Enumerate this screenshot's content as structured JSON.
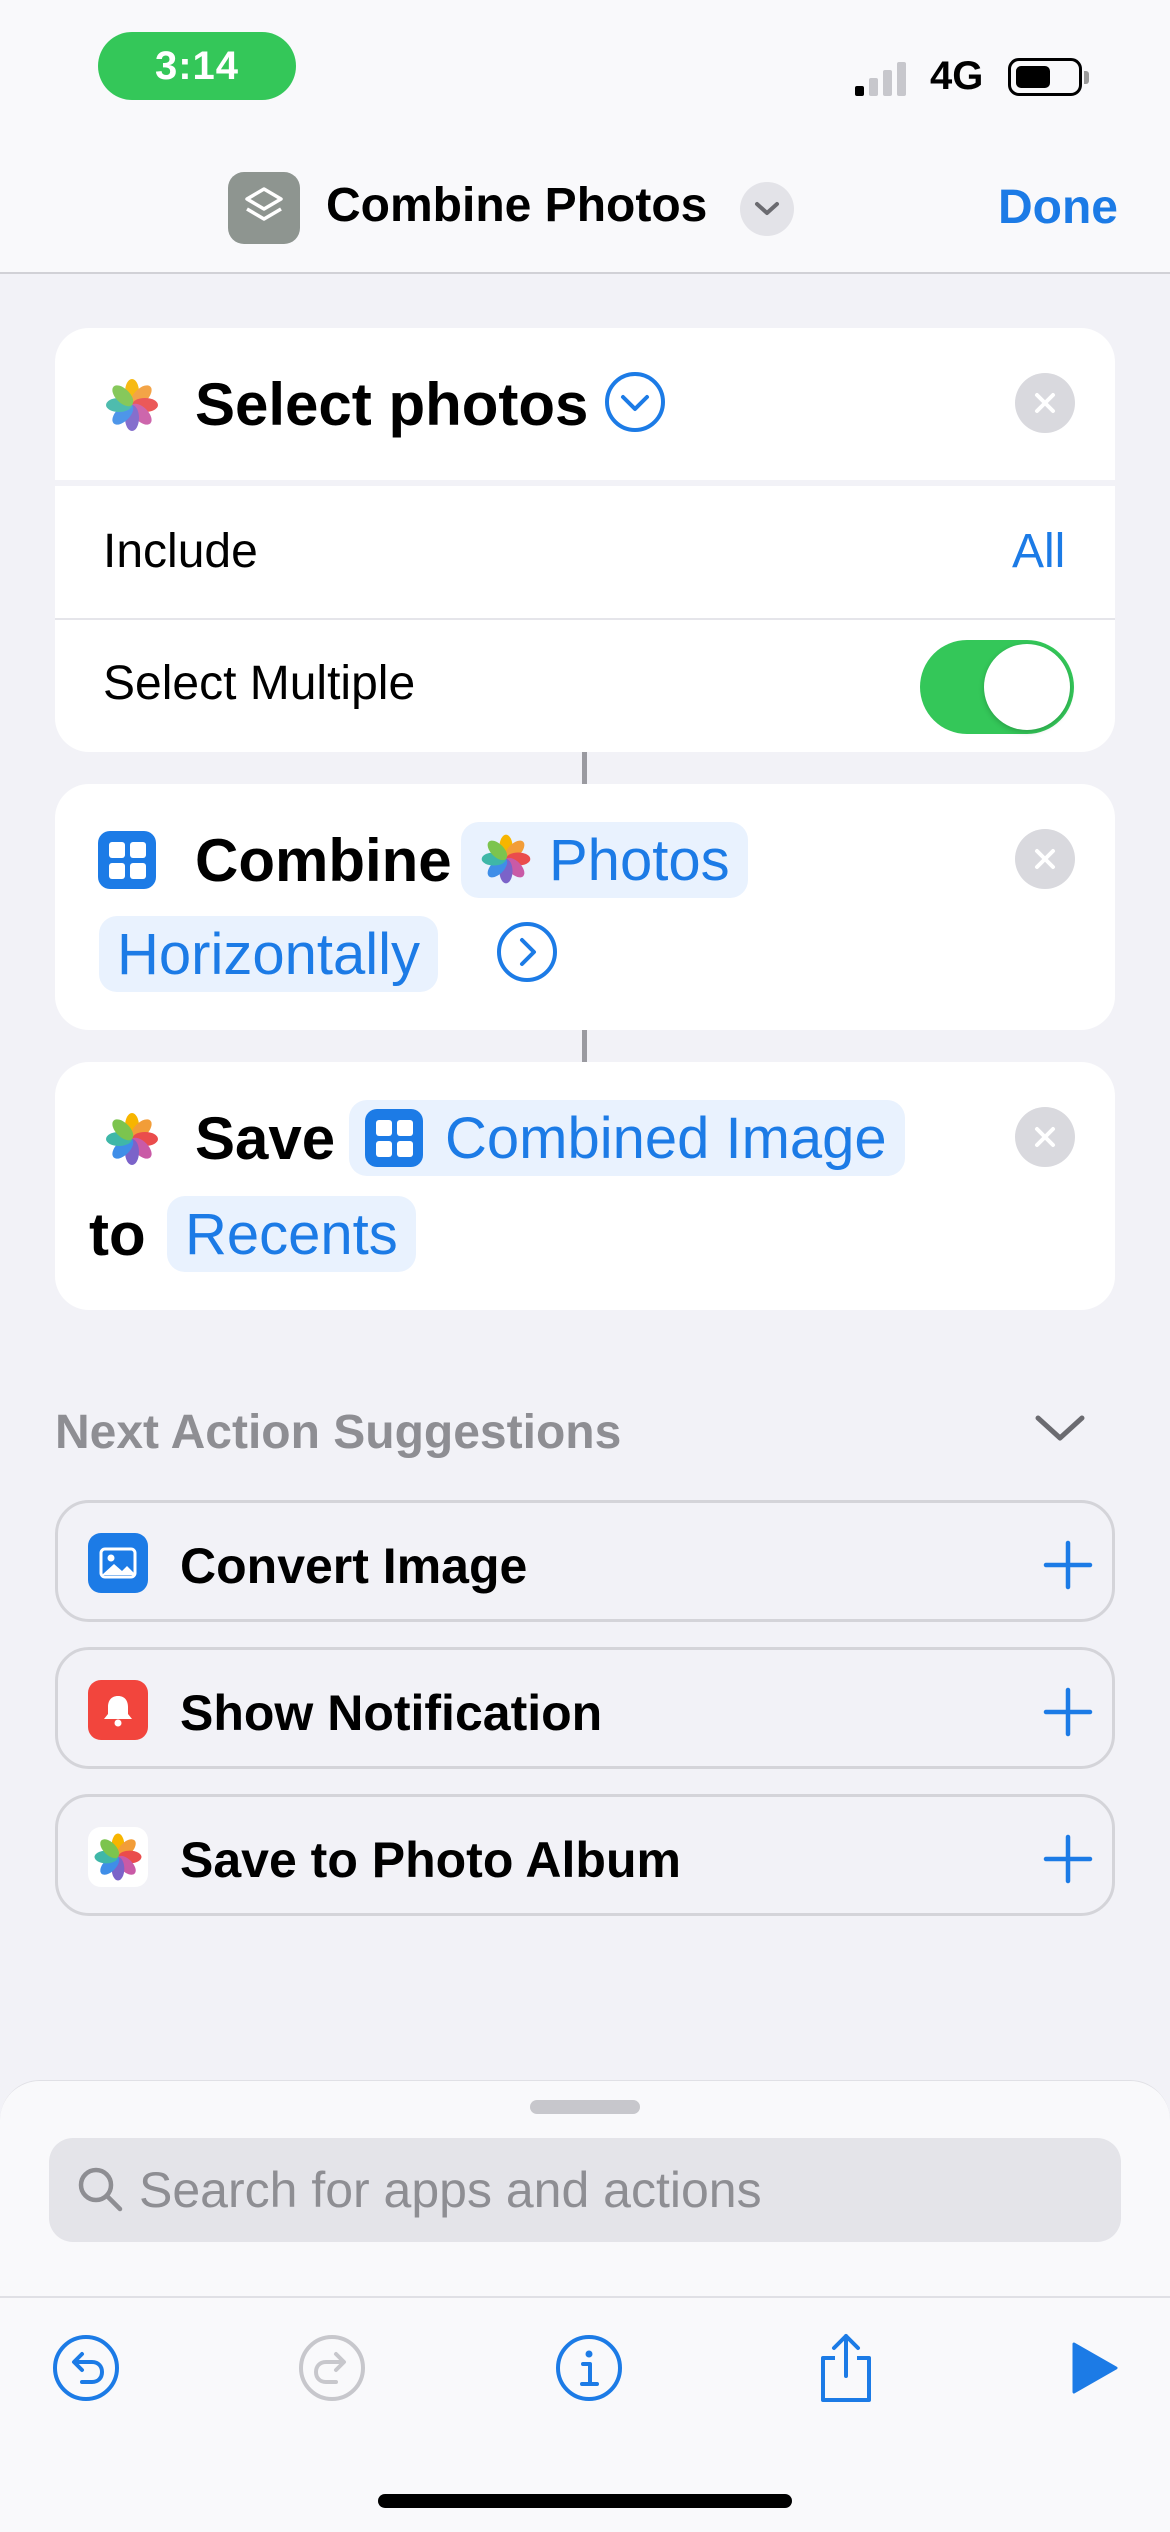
{
  "status_bar": {
    "time": "3:14",
    "network": "4G"
  },
  "nav": {
    "title": "Combine Photos",
    "done_label": "Done",
    "app_icon": "shortcuts-layers-icon",
    "menu_icon": "chevron-down-icon"
  },
  "actions": [
    {
      "id": "select-photos",
      "title": "Select photos",
      "icon": "photos-app-icon",
      "rows": [
        {
          "label": "Include",
          "value": "All"
        },
        {
          "label": "Select Multiple",
          "toggle": true
        }
      ]
    },
    {
      "id": "combine",
      "title": "Combine",
      "input_token": "Photos",
      "mode_token": "Horizontally",
      "icon": "combine-images-icon"
    },
    {
      "id": "save",
      "title": "Save",
      "input_token": "Combined Image",
      "preposition": "to",
      "destination_token": "Recents",
      "icon": "photos-app-icon"
    }
  ],
  "suggestions": {
    "header": "Next Action Suggestions",
    "items": [
      {
        "label": "Convert Image",
        "icon": "image-icon",
        "color": "#1c7be6"
      },
      {
        "label": "Show Notification",
        "icon": "bell-icon",
        "color": "#f2453d"
      },
      {
        "label": "Save to Photo Album",
        "icon": "photos-app-icon",
        "color": "#ffffff"
      }
    ]
  },
  "bottom_sheet": {
    "search_placeholder": "Search for apps and actions"
  },
  "toolbar": {
    "buttons": [
      "undo-icon",
      "redo-icon",
      "info-icon",
      "share-icon",
      "play-icon"
    ]
  },
  "colors": {
    "accent": "#1c7be6",
    "toggle_on": "#34c759",
    "background": "#f2f2f7"
  }
}
